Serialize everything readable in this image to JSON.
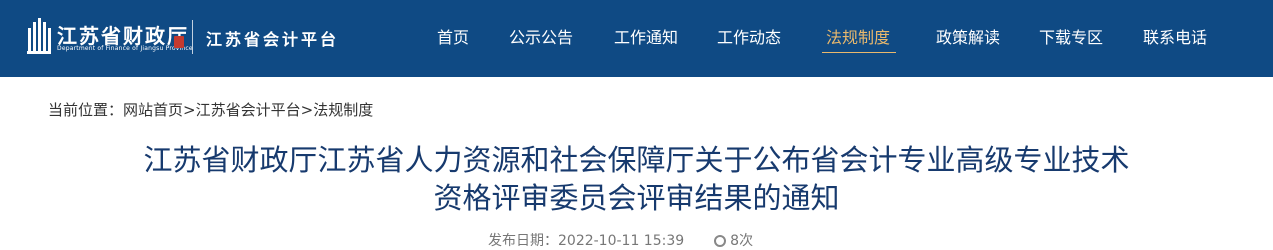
{
  "header": {
    "logo_title": "江苏省财政厅",
    "logo_subtitle": "Department of Finance of Jiangsu Province",
    "platform_name": "江苏省会计平台",
    "colors": {
      "background": "#0f4a84",
      "active": "#e8b86d",
      "text": "#ffffff"
    }
  },
  "nav": {
    "items": [
      {
        "label": "首页"
      },
      {
        "label": "公示公告"
      },
      {
        "label": "工作通知"
      },
      {
        "label": "工作动态"
      },
      {
        "label": "法规制度",
        "active": true
      },
      {
        "label": "政策解读"
      },
      {
        "label": "下载专区"
      },
      {
        "label": "联系电话"
      }
    ]
  },
  "breadcrumb": {
    "prefix": "当前位置：",
    "items": [
      "网站首页",
      "江苏省会计平台",
      "法规制度"
    ],
    "separator": ">"
  },
  "article": {
    "title_line1": "江苏省财政厅江苏省人力资源和社会保障厅关于公布省会计专业高级专业技术",
    "title_line2": "资格评审委员会评审结果的通知",
    "meta_published": "发布日期：2022-10-11 15:39",
    "meta_views": "8次",
    "meta_icon": "eye-icon"
  }
}
